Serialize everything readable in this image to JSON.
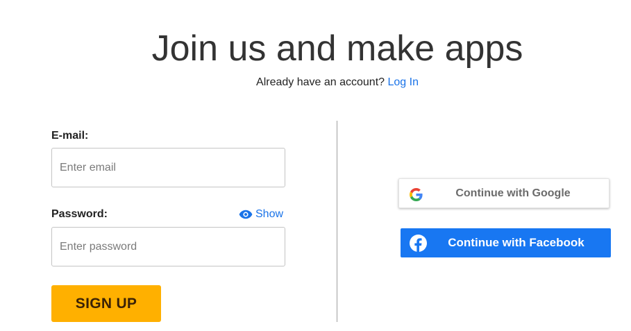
{
  "header": {
    "title": "Join us and make apps",
    "subtitle_text": "Already have an account?",
    "login_link": "Log In"
  },
  "form": {
    "email": {
      "label": "E-mail:",
      "placeholder": "Enter email",
      "value": ""
    },
    "password": {
      "label": "Password:",
      "placeholder": "Enter password",
      "value": "",
      "show_label": "Show",
      "show_icon": "eye-icon"
    },
    "signup_label": "SIGN UP"
  },
  "social": {
    "google": {
      "label": "Continue with Google",
      "icon": "google-icon"
    },
    "facebook": {
      "label": "Continue with Facebook",
      "icon": "facebook-icon"
    }
  },
  "colors": {
    "link": "#1a73e8",
    "signup_button": "#ffb000",
    "signup_text": "#3b2206",
    "facebook": "#1877f2",
    "title": "#333333"
  }
}
